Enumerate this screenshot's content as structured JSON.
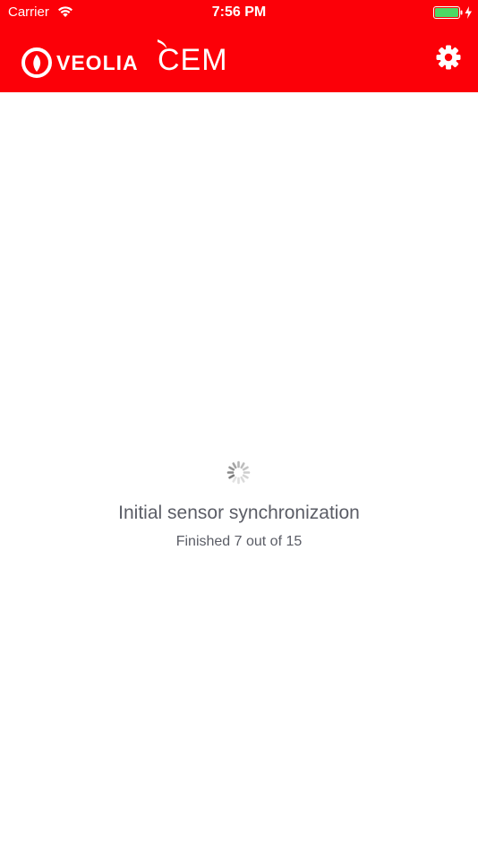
{
  "status_bar": {
    "carrier": "Carrier",
    "time": "7:56 PM",
    "wifi_icon": "wifi-icon",
    "battery_icon": "battery-charging-icon"
  },
  "header": {
    "brand_primary": "VEOLIA",
    "brand_secondary": "CEM",
    "settings_icon": "gear-icon",
    "background_color": "#fc0008"
  },
  "main": {
    "spinner_icon": "activity-spinner-icon",
    "title": "Initial sensor synchronization",
    "progress_text": "Finished 7 out of 15",
    "progress_done": 7,
    "progress_total": 15,
    "text_color": "#5b5d66"
  }
}
